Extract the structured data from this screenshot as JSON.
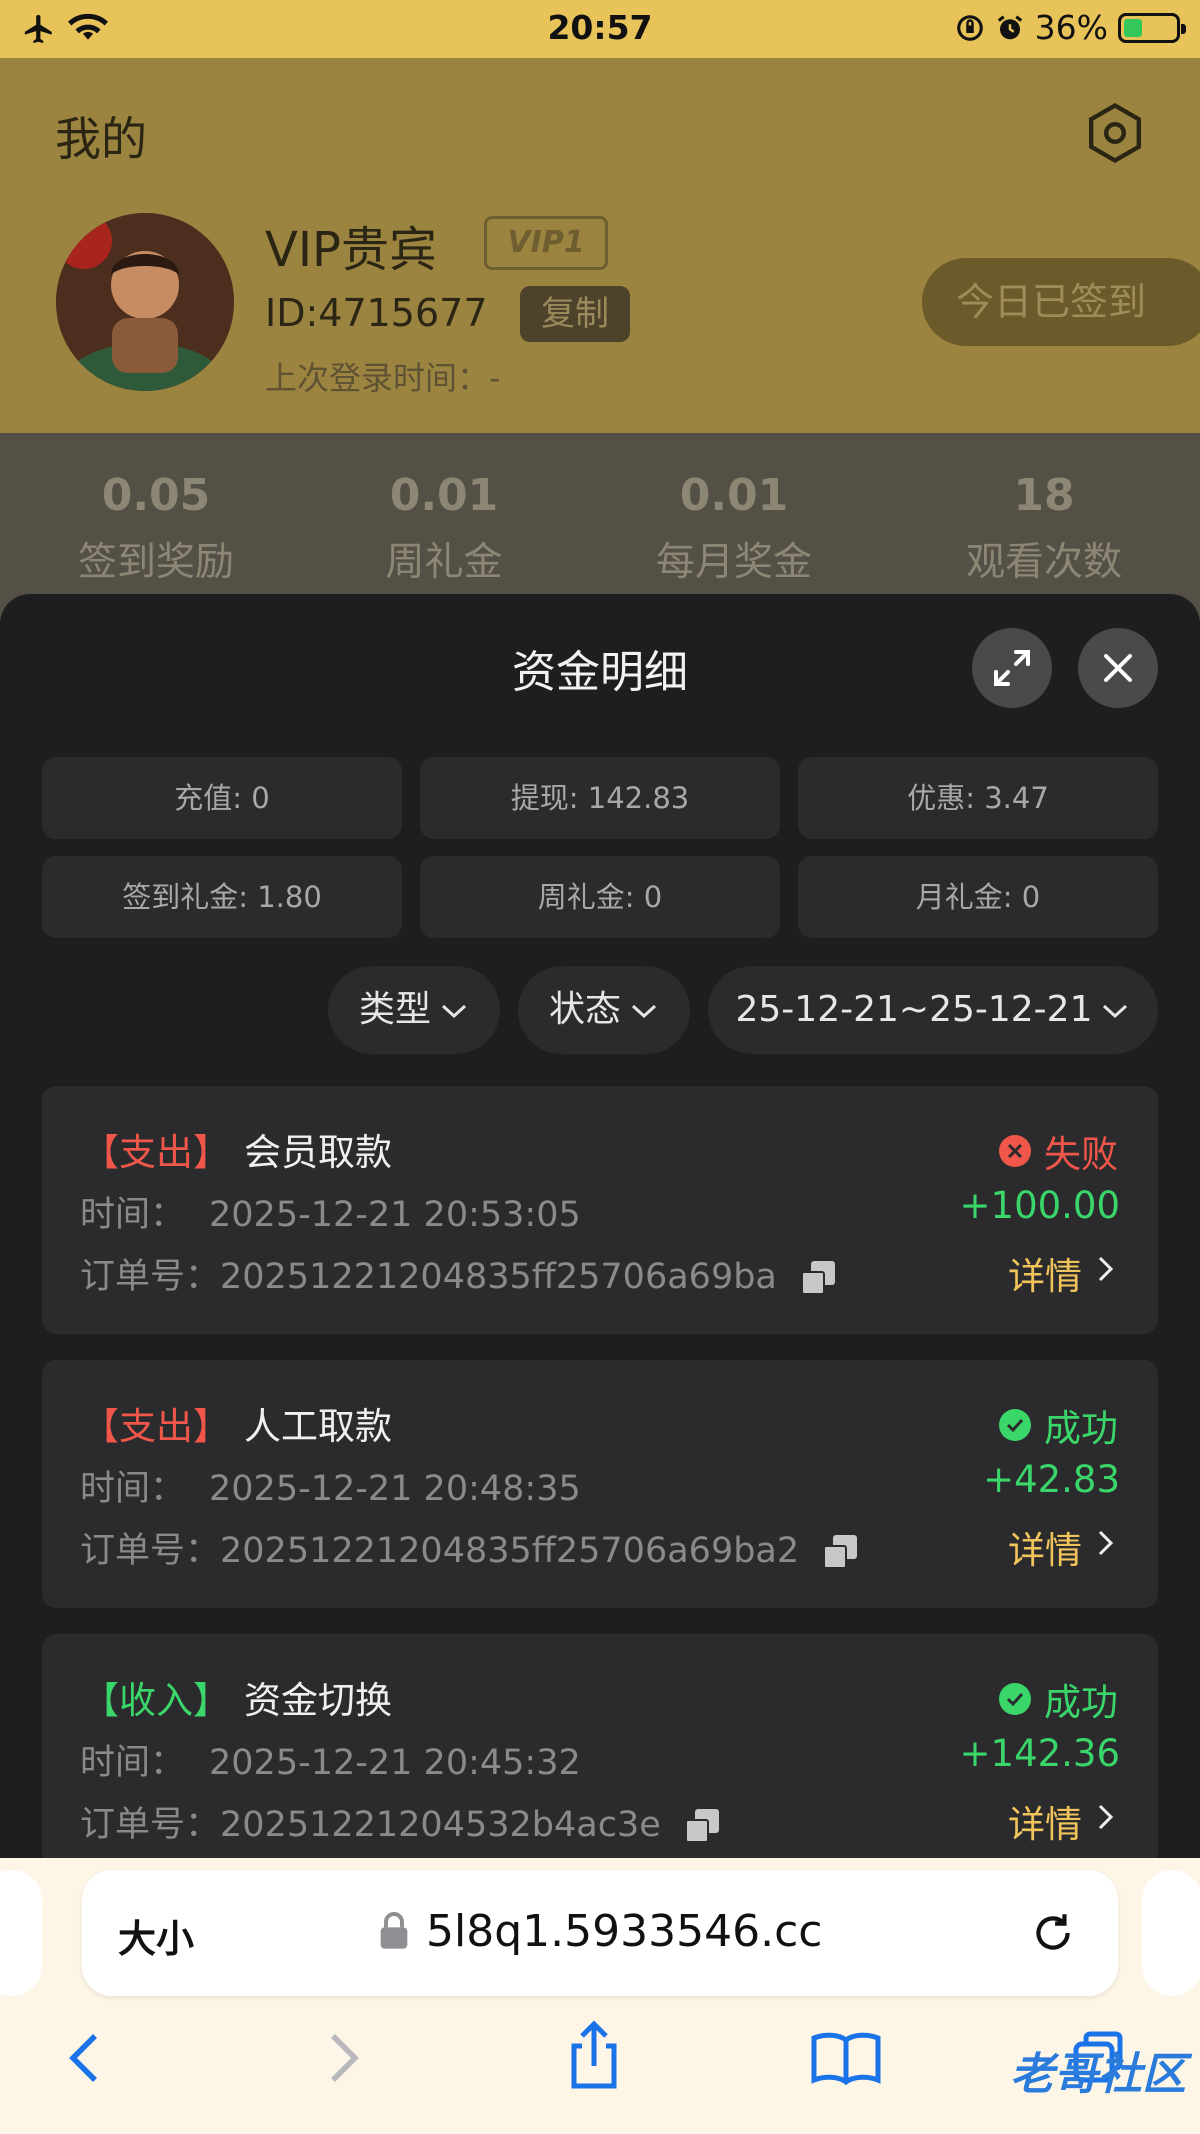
{
  "status_bar": {
    "time": "20:57",
    "battery": "36%",
    "battery_level": 0.36
  },
  "profile": {
    "page_title": "我的",
    "name": "VIP贵宾",
    "vip_badge": "VIP1",
    "id": "ID:4715677",
    "copy_label": "复制",
    "last_login": "上次登录时间：-",
    "signed_label": "今日已签到"
  },
  "stats": [
    {
      "value": "0.05",
      "label": "签到奖励"
    },
    {
      "value": "0.01",
      "label": "周礼金"
    },
    {
      "value": "0.01",
      "label": "每月奖金"
    },
    {
      "value": "18",
      "label": "观看次数"
    }
  ],
  "sheet": {
    "title": "资金明细",
    "summary": [
      "充值: 0",
      "提现: 142.83",
      "优惠: 3.47",
      "签到礼金: 1.80",
      "周礼金: 0",
      "月礼金: 0"
    ],
    "filters": {
      "type": "类型",
      "status": "状态",
      "date_range": "25-12-21~25-12-21"
    }
  },
  "records": [
    {
      "type": "【支出】",
      "name": "会员取款",
      "time_label": "时间：",
      "time": "2025-12-21 20:53:05",
      "order_label": "订单号：",
      "order": "20251221204835ff25706a69ba",
      "status": "失败",
      "amount": "+100.00",
      "detail": "详情"
    },
    {
      "type": "【支出】",
      "name": "人工取款",
      "time_label": "时间：",
      "time": "2025-12-21 20:48:35",
      "order_label": "订单号：",
      "order": "20251221204835ff25706a69ba2",
      "status": "成功",
      "amount": "+42.83",
      "detail": "详情"
    },
    {
      "type": "【收入】",
      "name": "资金切换",
      "time_label": "时间：",
      "time": "2025-12-21 20:45:32",
      "order_label": "订单号：",
      "order": "20251221204532b4ac3e",
      "status": "成功",
      "amount": "+142.36",
      "detail": "详情"
    }
  ],
  "browser": {
    "text_size_label": "大小",
    "url": "5l8q1.5933546.cc",
    "watermark": "老哥社区"
  }
}
